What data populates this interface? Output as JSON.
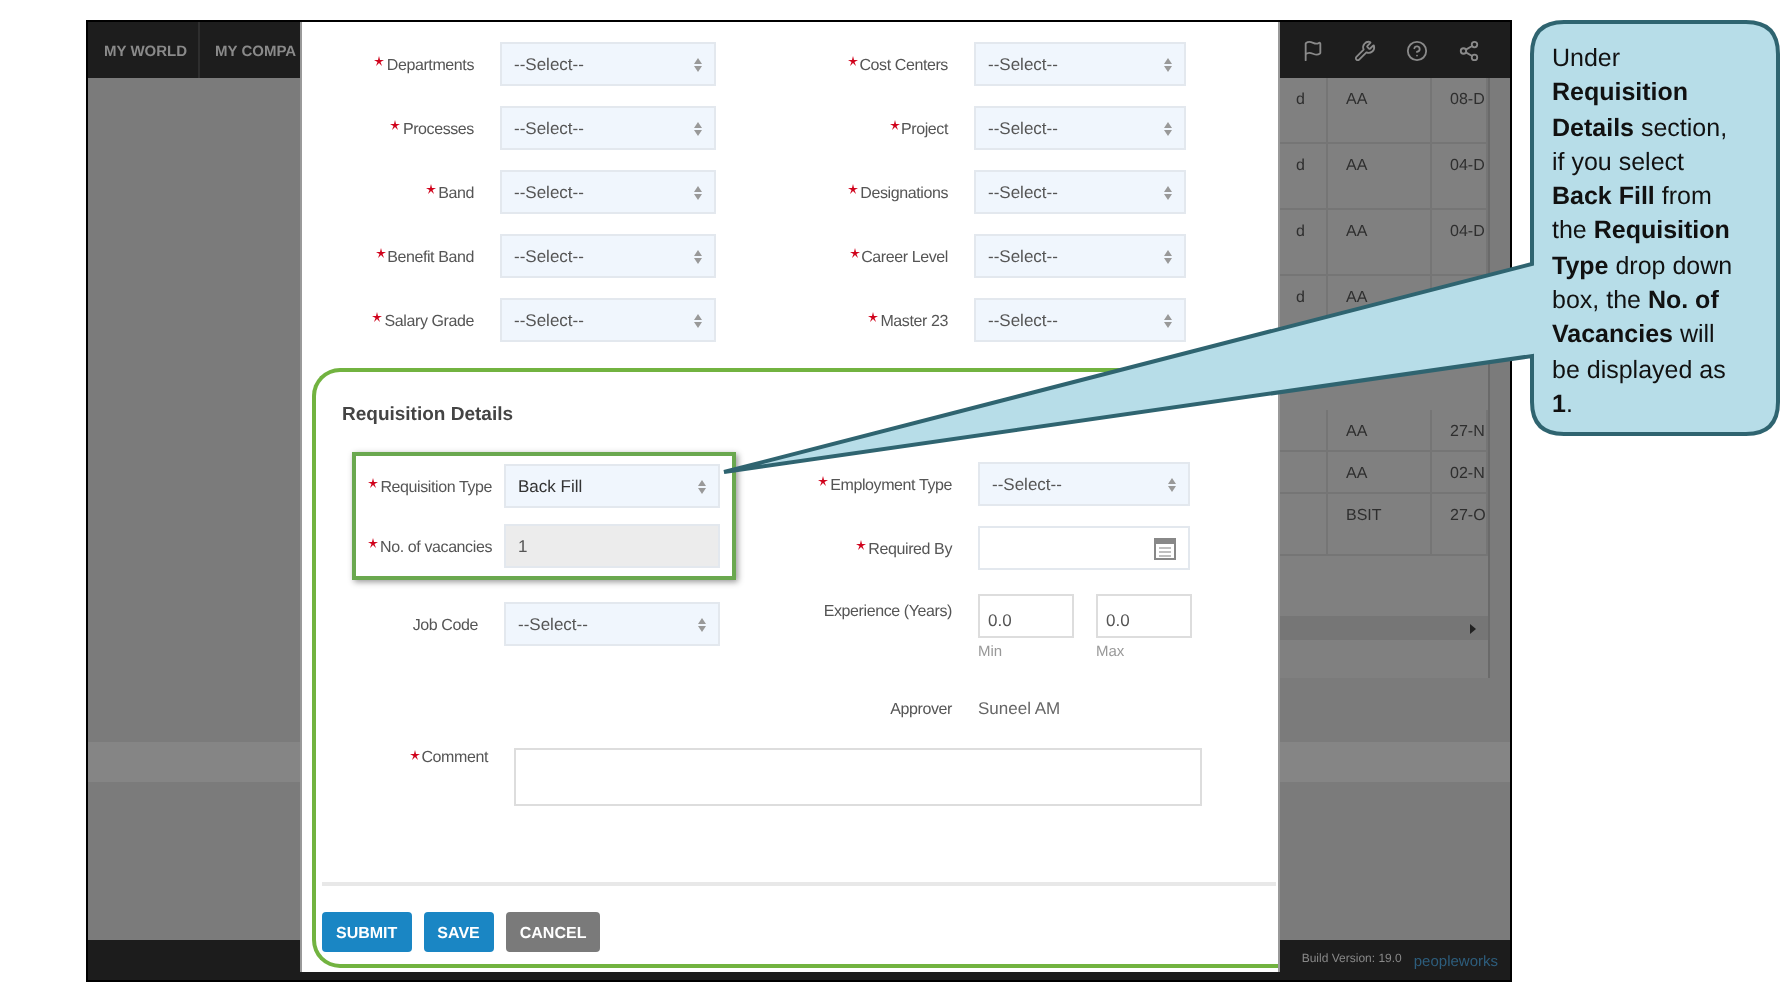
{
  "app_bar": {
    "nav_items": [
      "MY WORLD",
      "MY COMPA"
    ]
  },
  "background_table": {
    "rows": [
      {
        "col_1": "d",
        "col_2": "AA",
        "col_3": "08-D"
      },
      {
        "col_1": "d",
        "col_2": "AA",
        "col_3": "04-D"
      },
      {
        "col_1": "d",
        "col_2": "AA",
        "col_3": "04-D"
      },
      {
        "col_1": "d",
        "col_2": "AA"
      },
      {
        "col_2": "AA",
        "col_3": "27-N"
      },
      {
        "col_2": "AA",
        "col_3": "02-N"
      },
      {
        "col_2": "BSIT",
        "col_3": "27-O"
      }
    ]
  },
  "form": {
    "fields": [
      {
        "label": "Departments",
        "required": true,
        "value": "--Select--"
      },
      {
        "label": "Cost Centers",
        "required": true,
        "value": "--Select--"
      },
      {
        "label": "Processes",
        "required": true,
        "value": "--Select--"
      },
      {
        "label": "Project",
        "required": true,
        "value": "--Select--"
      },
      {
        "label": "Band",
        "required": true,
        "value": "--Select--"
      },
      {
        "label": "Designations",
        "required": true,
        "value": "--Select--"
      },
      {
        "label": "Benefit Band",
        "required": true,
        "value": "--Select--"
      },
      {
        "label": "Career Level",
        "required": true,
        "value": "--Select--"
      },
      {
        "label": "Salary Grade",
        "required": true,
        "value": "--Select--"
      },
      {
        "label": "Master 23",
        "required": true,
        "value": "--Select--"
      }
    ]
  },
  "requisition_details": {
    "title": "Requisition Details",
    "highlighted_fields": [
      {
        "label": "Requisition Type",
        "required": true,
        "kind": "select",
        "value": "Back Fill"
      },
      {
        "label": "No. of vacancies",
        "required": true,
        "kind": "readonly",
        "value": "1"
      }
    ],
    "side_fields": [
      {
        "label": "Employment Type",
        "required": true,
        "kind": "select",
        "value": "--Select--"
      },
      {
        "label": "Required By",
        "required": true,
        "kind": "date"
      }
    ],
    "job_code": {
      "label": "Job Code",
      "required": false,
      "kind": "select",
      "value": "--Select--"
    },
    "experience": {
      "label": "Experience (Years)",
      "min": {
        "value": "0.0",
        "caption": "Min"
      },
      "max": {
        "value": "0.0",
        "caption": "Max"
      }
    },
    "approver": {
      "label": "Approver",
      "value": "Suneel AM"
    },
    "comment": {
      "label": "Comment",
      "required": true
    }
  },
  "buttons": [
    {
      "label": "SUBMIT",
      "kind": "primary"
    },
    {
      "label": "SAVE",
      "kind": "primary"
    },
    {
      "label": "CANCEL",
      "kind": "secondary"
    }
  ],
  "footer": {
    "build_version": "Build Version: 19.0",
    "logo": "peopleworks"
  },
  "callout": {
    "text": "Under **Requisition Details** section, if you select **Back Fill** from the **Requisition Type** drop down box, the **No. of Vacancies** will be displayed as **1**."
  }
}
